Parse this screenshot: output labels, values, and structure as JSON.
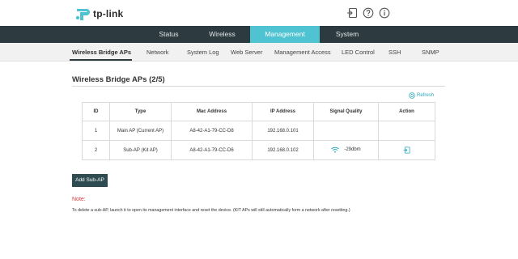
{
  "header": {
    "brand": "tp-link",
    "colors": {
      "brand": "#4fc3d1",
      "nav_bg": "#2d3a3f",
      "button_bg": "#2d4b50",
      "note": "#d23b3b",
      "link": "#2aa6bb"
    },
    "icons": [
      "logout-icon",
      "help-icon",
      "info-icon"
    ]
  },
  "mainnav": {
    "tabs": [
      {
        "label": "Status",
        "active": false
      },
      {
        "label": "Wireless",
        "active": false
      },
      {
        "label": "Management",
        "active": true
      },
      {
        "label": "System",
        "active": false
      }
    ]
  },
  "subnav": {
    "items": [
      {
        "label": "Wireless Bridge APs",
        "active": true
      },
      {
        "label": "Network",
        "active": false
      },
      {
        "label": "System Log",
        "active": false
      },
      {
        "label": "Web Server",
        "active": false
      },
      {
        "label": "Management Access",
        "active": false
      },
      {
        "label": "LED Control",
        "active": false
      },
      {
        "label": "SSH",
        "active": false
      },
      {
        "label": "SNMP",
        "active": false
      }
    ]
  },
  "section": {
    "title": "Wireless Bridge APs (2/5)",
    "refresh_label": "Refresh"
  },
  "table": {
    "columns": [
      "ID",
      "Type",
      "Mac Address",
      "IP Address",
      "Signal Quality",
      "Action"
    ],
    "rows": [
      {
        "id": "1",
        "type": "Main AP (Current AP)",
        "mac": "A8-42-A1-79-CC-D8",
        "ip": "192.168.0.101",
        "signal": "",
        "action_icon": ""
      },
      {
        "id": "2",
        "type": "Sub-AP (Kit AP)",
        "mac": "A8-42-A1-79-CC-D6",
        "ip": "192.168.0.102",
        "signal": "-29dbm",
        "signal_icon": "wifi-icon",
        "action_icon": "login-icon"
      }
    ]
  },
  "buttons": {
    "add_sub_ap": "Add Sub-AP"
  },
  "note": {
    "title": "Note:",
    "text": "To delete a sub-AP, launch it to open its management interface and reset the device. (KIT APs will still automatically form a network after resetting.)"
  }
}
